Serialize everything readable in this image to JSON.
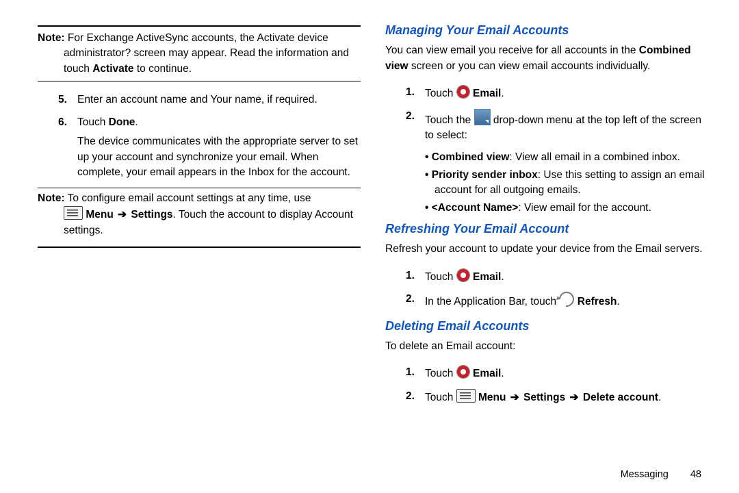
{
  "left": {
    "note1": {
      "label": "Note:",
      "text": "For Exchange ActiveSync accounts, the Activate device administrator? screen may appear. Read the information and touch ",
      "bold": "Activate",
      "tail": " to continue."
    },
    "steps": {
      "s5": "Enter an account name and Your name, if required.",
      "s6a": "Touch ",
      "s6b": "Done",
      "s6c": ".",
      "s6body": "The device communicates with the appropriate server to set up your account and synchronize your email. When complete, your email appears in the Inbox for the account."
    },
    "note2": {
      "label": "Note:",
      "pre": "To configure email account settings at any time, use ",
      "menu": "Menu",
      "arrow": " ➔ ",
      "settings": "Settings",
      "post": ". Touch the account to display Account settings."
    }
  },
  "right": {
    "manage": {
      "heading": "Managing Your Email Accounts",
      "intro1": "You can view email you receive for all accounts in the ",
      "intro_bold": "Combined view",
      "intro2": " screen or you can view email accounts individually.",
      "s1a": "Touch ",
      "s1b": "Email",
      "s1c": ".",
      "s2a": "Touch the ",
      "s2b": " drop-down menu at the top left of the screen to select:",
      "b1a": "Combined view",
      "b1b": ": View all email in a combined inbox.",
      "b2a": "Priority sender inbox",
      "b2b": ": Use this setting to assign an email account for all outgoing emails.",
      "b3a": "<Account Name>",
      "b3b": ": View email for the account."
    },
    "refresh": {
      "heading": "Refreshing Your Email Account",
      "intro": "Refresh your account to update your device from the Email servers.",
      "s1a": "Touch ",
      "s1b": "Email",
      "s1c": ".",
      "s2a": "In the Application Bar, touch ",
      "s2b": "Refresh",
      "s2c": "."
    },
    "del": {
      "heading": "Deleting Email Accounts",
      "intro": "To delete an Email account:",
      "s1a": "Touch ",
      "s1b": "Email",
      "s1c": ".",
      "s2a": "Touch ",
      "s2b": "Menu",
      "arrow": " ➔ ",
      "s2c": "Settings",
      "s2d": "Delete account",
      "s2e": "."
    }
  },
  "footer": {
    "chapter": "Messaging",
    "page": "48"
  }
}
